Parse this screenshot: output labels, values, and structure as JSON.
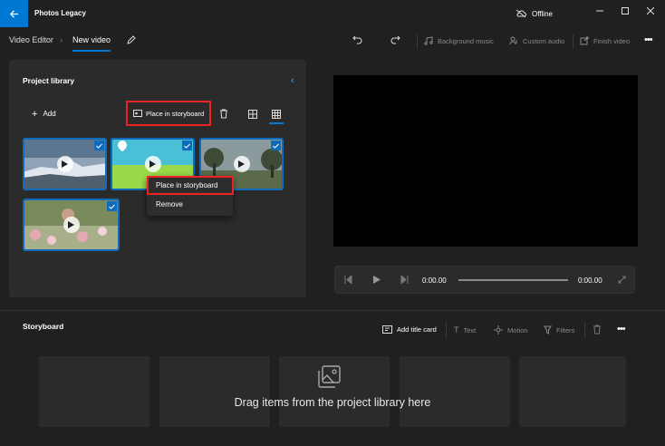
{
  "app": {
    "title": "Photos Legacy",
    "status": "Offline"
  },
  "breadcrumb": {
    "root": "Video Editor",
    "current": "New video"
  },
  "toolbar": {
    "background_music": "Background music",
    "custom_audio": "Custom audio",
    "finish_video": "Finish video"
  },
  "library": {
    "title": "Project library",
    "add_label": "Add",
    "place_label": "Place in storyboard",
    "items": [
      {
        "name": "mountains-clip",
        "selected": true
      },
      {
        "name": "balloon-clip",
        "selected": true
      },
      {
        "name": "trees-clip",
        "selected": true
      },
      {
        "name": "flowers-clip",
        "selected": true
      }
    ]
  },
  "context_menu": {
    "items": [
      "Place in storyboard",
      "Remove"
    ]
  },
  "player": {
    "current_time": "0:00.00",
    "total_time": "0:00.00",
    "progress": 0
  },
  "storyboard": {
    "title": "Storyboard",
    "add_title_card": "Add title card",
    "text": "Text",
    "motion": "Motion",
    "filters": "Filters",
    "empty_message": "Drag items from the project library here"
  },
  "colors": {
    "accent": "#0078d4",
    "highlight": "#e22222",
    "panel": "#2b2b2b"
  }
}
